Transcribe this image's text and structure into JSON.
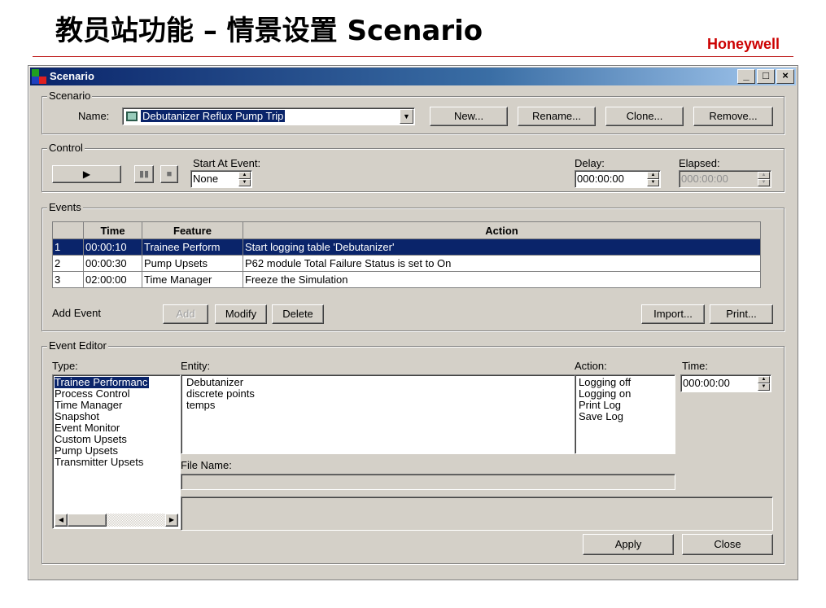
{
  "slide": {
    "title": "教员站功能 – 情景设置 Scenario",
    "brand": "Honeywell"
  },
  "window": {
    "title": "Scenario",
    "minimize": "_",
    "maximize": "□",
    "close": "×"
  },
  "scenario_group": {
    "label": "Scenario",
    "name_label": "Name:",
    "name_value": "Debutanizer Reflux Pump Trip",
    "buttons": {
      "new": "New...",
      "rename": "Rename...",
      "clone": "Clone...",
      "remove": "Remove..."
    }
  },
  "control_group": {
    "label": "Control",
    "start_at_event_label": "Start At Event:",
    "start_at_event_value": "None",
    "delay_label": "Delay:",
    "delay_value": "000:00:00",
    "elapsed_label": "Elapsed:",
    "elapsed_value": "000:00:00",
    "icons": [
      "play-icon",
      "pause-icon",
      "stop-icon"
    ]
  },
  "events_group": {
    "label": "Events",
    "columns": [
      "",
      "Time",
      "Feature",
      "Action"
    ],
    "rows": [
      {
        "num": "1",
        "time": "00:00:10",
        "feature": "Trainee Perform",
        "action": "Start logging table 'Debutanizer'"
      },
      {
        "num": "2",
        "time": "00:00:30",
        "feature": "Pump Upsets",
        "action": "P62 module Total Failure  Status is set to On"
      },
      {
        "num": "3",
        "time": "02:00:00",
        "feature": "Time Manager",
        "action": "Freeze the Simulation"
      }
    ],
    "add_event_label": "Add Event",
    "buttons": {
      "add": "Add",
      "modify": "Modify",
      "delete": "Delete",
      "import": "Import...",
      "print": "Print..."
    }
  },
  "event_editor": {
    "label": "Event Editor",
    "type_label": "Type:",
    "types": [
      "Trainee Performanc",
      "Process Control",
      "Time Manager",
      "Snapshot",
      "Event Monitor",
      "Custom Upsets",
      "Pump Upsets",
      "Transmitter Upsets"
    ],
    "entity_label": "Entity:",
    "entities": [
      "Debutanizer",
      "discrete points",
      "temps"
    ],
    "action_label": "Action:",
    "actions": [
      "Logging off",
      "Logging on",
      "Print Log",
      "Save Log"
    ],
    "time_label": "Time:",
    "time_value": "000:00:00",
    "file_name_label": "File Name:",
    "buttons": {
      "apply": "Apply",
      "close": "Close"
    }
  },
  "colors": {
    "selection": "#0a246a",
    "face": "#d4d0c8",
    "brand": "#cc0000"
  }
}
